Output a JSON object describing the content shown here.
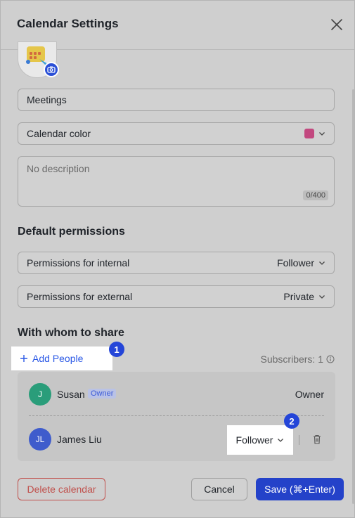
{
  "dialog": {
    "title": "Calendar Settings"
  },
  "calendar": {
    "name_value": "Meetings",
    "color_label": "Calendar color",
    "color": "#c2487f",
    "description_placeholder": "No description",
    "description_counter": "0/400"
  },
  "permissions": {
    "section_title": "Default permissions",
    "internal_label": "Permissions for internal",
    "internal_value": "Follower",
    "external_label": "Permissions for external",
    "external_value": "Private"
  },
  "share": {
    "section_title": "With whom to share",
    "add_people": "Add People",
    "subscribers": "Subscribers: 1",
    "members": [
      {
        "initials": "J",
        "name": "Susan",
        "tag": "Owner",
        "role": "Owner",
        "color": "#2a9d7a"
      },
      {
        "initials": "JL",
        "name": "James Liu",
        "tag": "",
        "role": "Follower",
        "color": "#3f5ccc"
      }
    ]
  },
  "badges": {
    "one": "1",
    "two": "2"
  },
  "footer": {
    "delete_label": "Delete calendar",
    "cancel_label": "Cancel",
    "save_label": "Save (⌘+Enter)"
  },
  "colors": {
    "accent": "#2442c9",
    "danger": "#c0504c",
    "link": "#2a58e6"
  },
  "icons": [
    "close-icon",
    "camera-icon",
    "chevron-down-icon",
    "info-icon",
    "plus-icon",
    "trash-icon"
  ]
}
